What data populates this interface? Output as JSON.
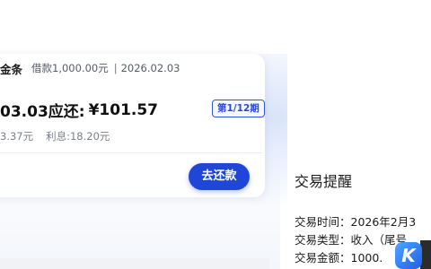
{
  "card": {
    "brand": "金条",
    "loan_label": "借款1,000.00元",
    "separator": "|",
    "date": "2026.02.03",
    "due_date_text": "03.03应还:",
    "due_amount": "¥101.57",
    "period_badge": "第1/12期",
    "principal_text": "3.37元",
    "interest_text": "利息:18.20元",
    "repay_button": "去还款"
  },
  "notification": {
    "title": "交易提醒",
    "line1": "交易时间：2026年2月3",
    "line2": "交易类型：收入（尾号",
    "line3": "交易金额：1000."
  },
  "colors": {
    "accent": "#2046d8"
  },
  "icons": {
    "app_icon": "k-app-icon"
  }
}
